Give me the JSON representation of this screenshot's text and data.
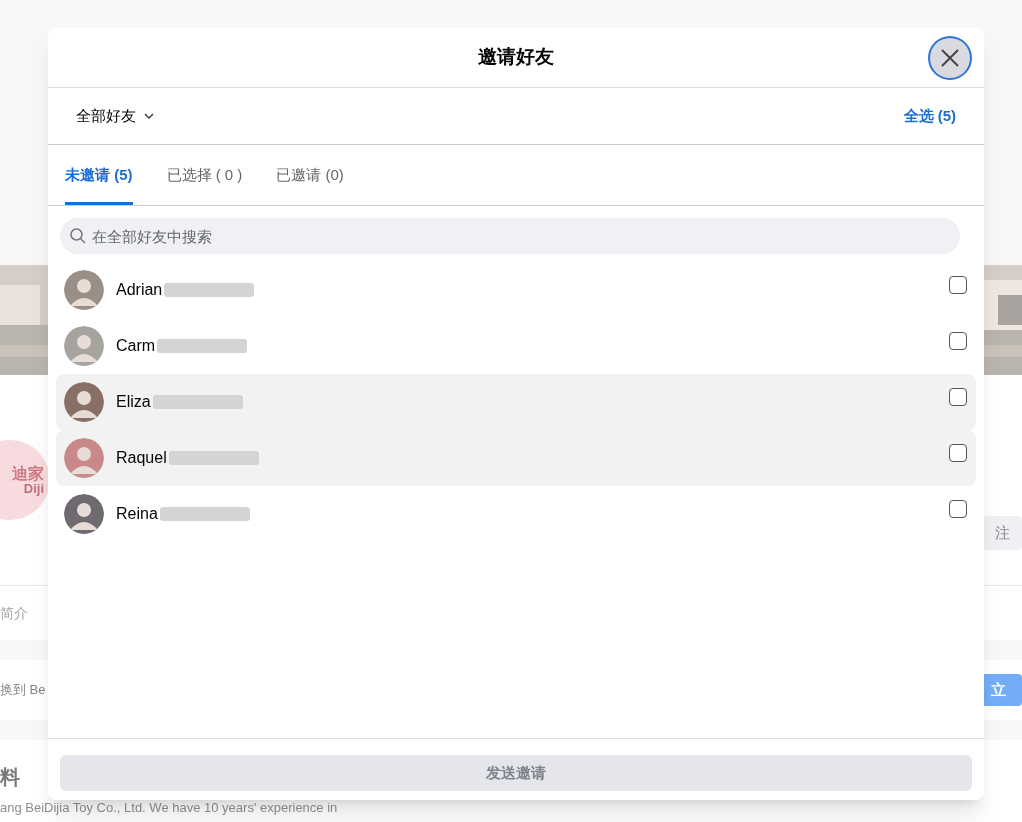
{
  "background": {
    "logo_lines": [
      "迪家",
      "Diji"
    ],
    "follow_button": "注",
    "about_tab": "简介",
    "switch_text": "换到 Be",
    "switch_button": "立",
    "info_heading": "料",
    "info_text": "ang BeiDijia Toy Co., Ltd. We have 10 years' experience in"
  },
  "dialog": {
    "title": "邀请好友",
    "filter": "全部好友",
    "select_all": "全选 (5)",
    "tabs": [
      {
        "label": "未邀请 (5)",
        "selected": true
      },
      {
        "label": "已选择 ( 0 )",
        "selected": false
      },
      {
        "label": "已邀请 (0)",
        "selected": false
      }
    ],
    "search": {
      "placeholder": "在全部好友中搜索"
    },
    "friends": [
      {
        "name": "Adrian",
        "checked": false,
        "highlighted": false
      },
      {
        "name": "Carm",
        "checked": false,
        "highlighted": false
      },
      {
        "name": "Eliza",
        "checked": false,
        "highlighted": true
      },
      {
        "name": "Raquel",
        "checked": false,
        "highlighted": true
      },
      {
        "name": "Reina",
        "checked": false,
        "highlighted": false
      }
    ],
    "send_button": {
      "label": "发送邀请",
      "disabled": true
    }
  }
}
